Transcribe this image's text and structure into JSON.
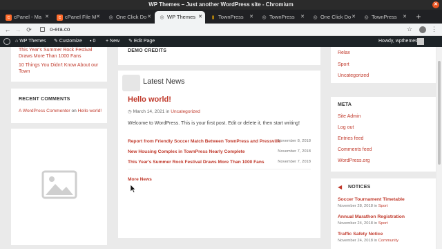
{
  "window": {
    "title": "WP Themes – Just another WordPress site - Chromium"
  },
  "tabs": [
    {
      "label": "cPanel - Ma",
      "icon_color": "#ff6c2c",
      "glyph": "c"
    },
    {
      "label": "cPanel File M",
      "icon_color": "#ff6c2c",
      "glyph": "c"
    },
    {
      "label": "One Click Do",
      "icon_color": "#cccccc",
      "glyph": "◎"
    },
    {
      "label": "WP Themes",
      "icon_color": "#888888",
      "glyph": "◎",
      "active": true
    },
    {
      "label": "TownPress",
      "icon_color": "#b8860b",
      "glyph": "▮"
    },
    {
      "label": "TownPress",
      "icon_color": "#cccccc",
      "glyph": "◎"
    },
    {
      "label": "One Click Do",
      "icon_color": "#cccccc",
      "glyph": "◎"
    },
    {
      "label": "TownPress",
      "icon_color": "#cccccc",
      "glyph": "◎"
    }
  ],
  "address": {
    "url": "o-era.co"
  },
  "adminbar": {
    "site": "WP Themes",
    "customize": "Customize",
    "comments": "0",
    "new": "New",
    "edit": "Edit Page",
    "howdy": "Howdy, wpthemes"
  },
  "left": {
    "posts": [
      "This Year's Summer Rock Festival Draws More Than 1000 Fans",
      "10 Things You Didn't Know About our Town"
    ],
    "recent_comments_title": "RECENT COMMENTS",
    "comment_author": "A WordPress Commenter",
    "comment_on": "on",
    "comment_post": "Hello world!"
  },
  "center": {
    "demo_credits": "DEMO CREDITS",
    "latest_news": "Latest News",
    "post_title": "Hello world!",
    "post_date": "March 14, 2021",
    "post_in": "in",
    "post_category": "Uncategorized",
    "post_excerpt": "Welcome to WordPress. This is your first post. Edit or delete it, then start writing!",
    "news": [
      {
        "title": "Report from Friendly Soccer Match Between TownPress and Pressville",
        "date": "November 8, 2018"
      },
      {
        "title": "New Housing Complex in TownPress Nearly Complete",
        "date": "November 7, 2018"
      },
      {
        "title": "This Year's Summer Rock Festival Draws More Than 1000 Fans",
        "date": "November 7, 2018"
      }
    ],
    "more_news": "More News"
  },
  "right": {
    "categories": [
      "Relax",
      "Sport",
      "Uncategorized"
    ],
    "meta_title": "META",
    "meta": [
      "Site Admin",
      "Log out",
      "Entries feed",
      "Comments feed",
      "WordPress.org"
    ],
    "notices_title": "NOTICES",
    "notices": [
      {
        "title": "Soccer Tournament Timetable",
        "date": "November 28, 2018",
        "in": "in",
        "category": "Sport"
      },
      {
        "title": "Annual Marathon Registration",
        "date": "November 24, 2018",
        "in": "in",
        "category": "Sport"
      },
      {
        "title": "Traffic Safety Notice",
        "date": "November 24, 2018",
        "in": "in",
        "category": "Community"
      }
    ]
  }
}
